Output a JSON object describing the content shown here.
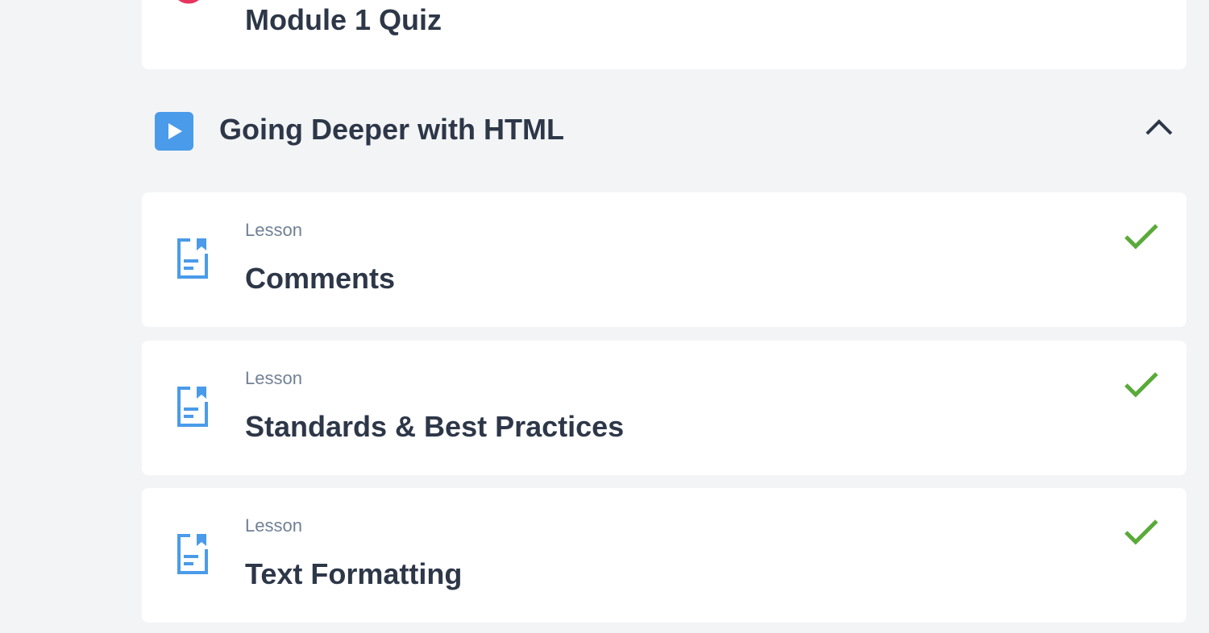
{
  "quiz": {
    "title": "Module 1 Quiz"
  },
  "section": {
    "title": "Going Deeper with HTML"
  },
  "lessons": [
    {
      "type": "Lesson",
      "title": "Comments",
      "completed": true
    },
    {
      "type": "Lesson",
      "title": "Standards & Best Practices",
      "completed": true
    },
    {
      "type": "Lesson",
      "title": "Text Formatting",
      "completed": true
    }
  ],
  "colors": {
    "accent": "#4a9be9",
    "quiz": "#e53560",
    "check": "#5aaa3a"
  }
}
